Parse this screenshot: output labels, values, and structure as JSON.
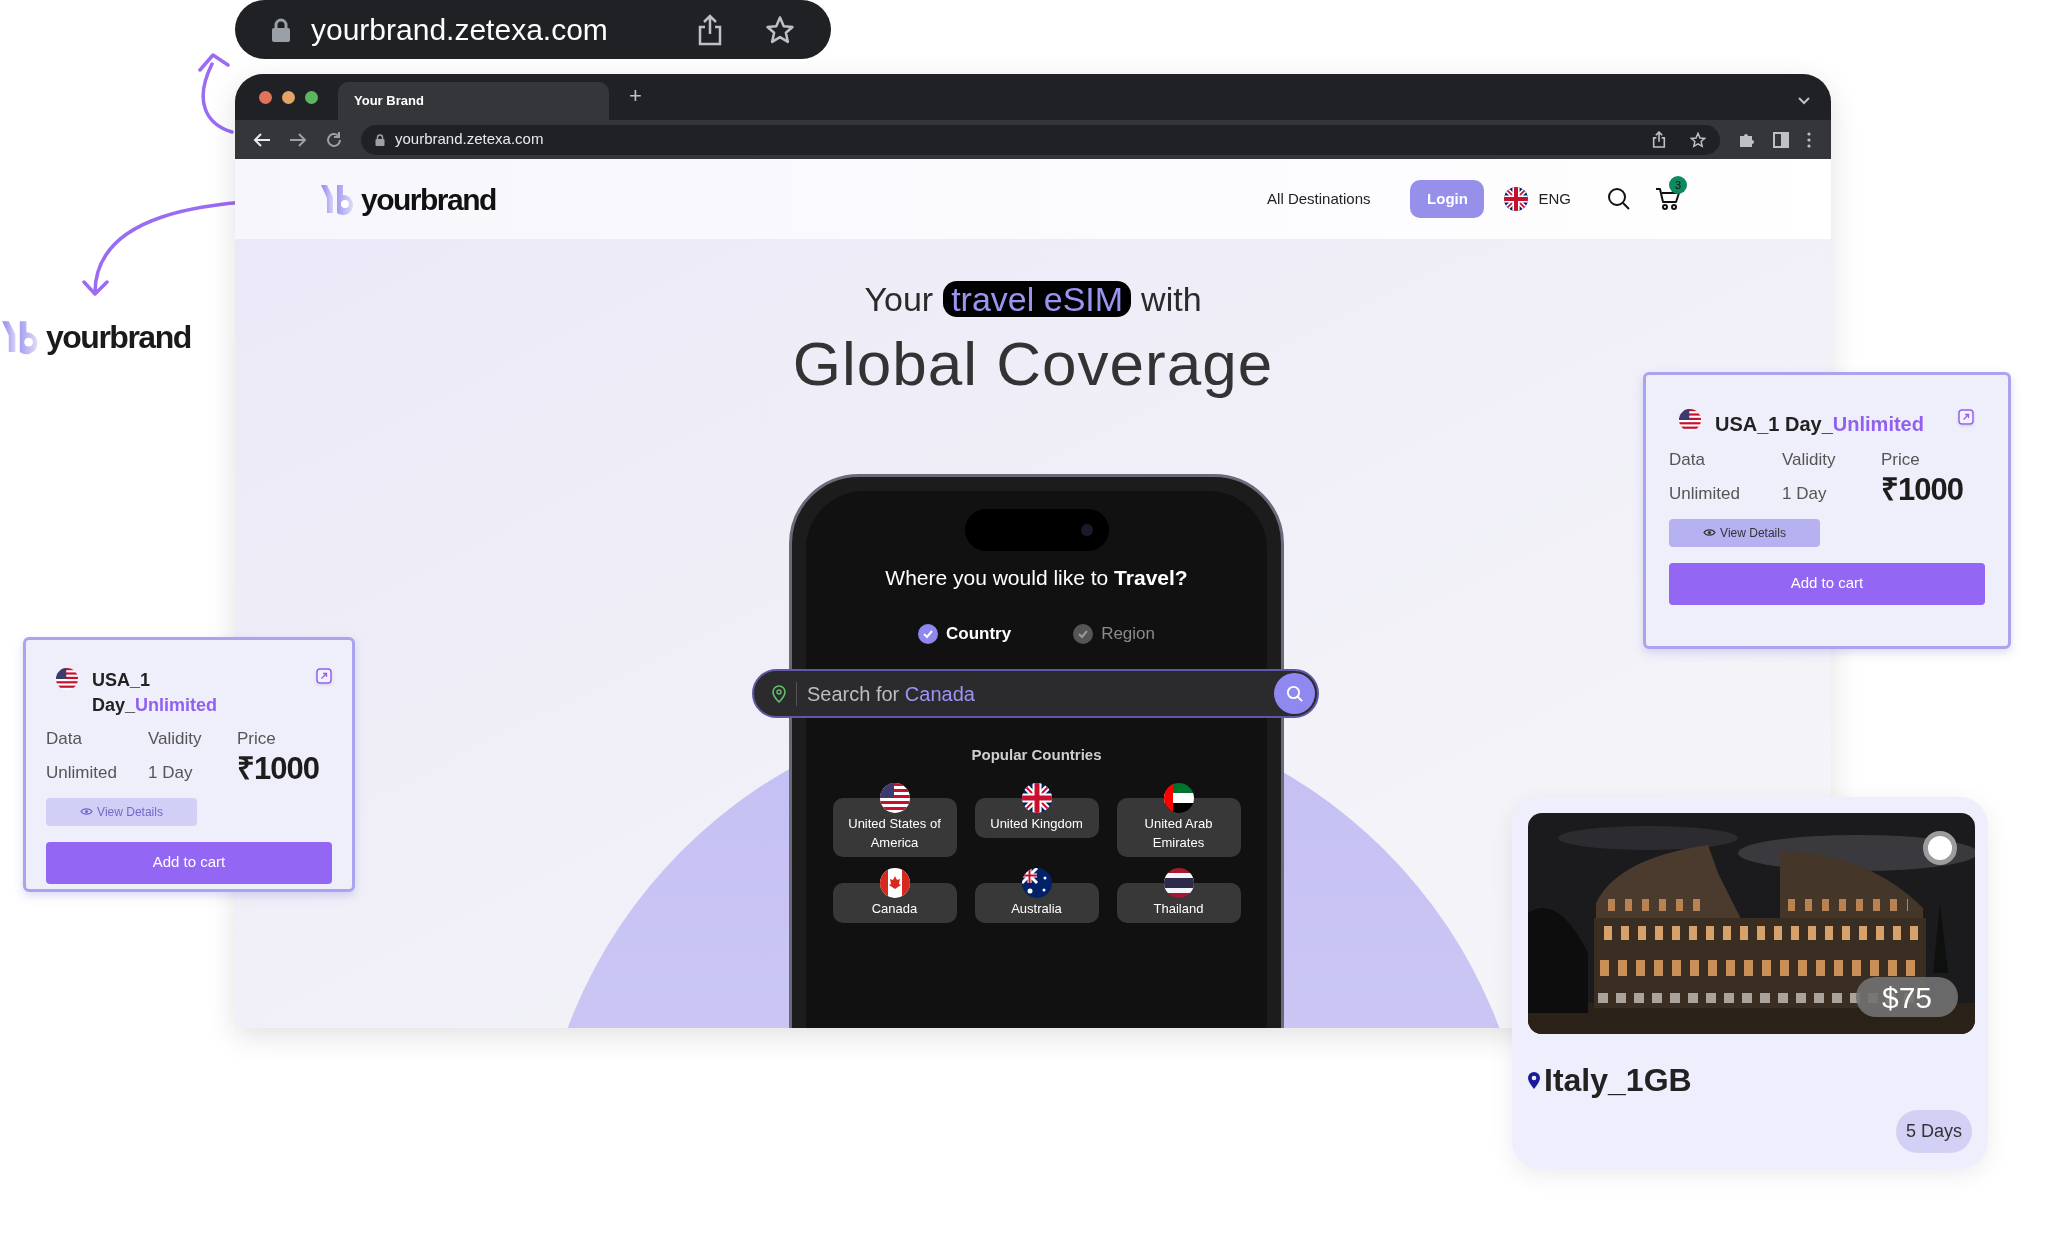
{
  "address_bar": {
    "url": "yourbrand.zetexa.com"
  },
  "browser": {
    "tabs": [
      {
        "title": "Your Brand",
        "selected": true
      }
    ],
    "new_tab": "+",
    "url": "yourbrand.zetexa.com"
  },
  "site": {
    "logo": "yourbrand",
    "nav": [
      "All Destinations"
    ],
    "login": "Login",
    "language": "ENG",
    "cart_count": "3"
  },
  "hero": {
    "before": "Your",
    "highlight": "travel eSIM",
    "after": "with",
    "title": "Global Coverage"
  },
  "phone": {
    "question": "Where you would like to **Travel?**",
    "options": [
      {
        "label": "Country",
        "selected": true
      },
      {
        "label": "Region",
        "selected": false
      }
    ],
    "search_prefix": "Search for",
    "search_term": "Canada",
    "popular_title": "Popular Countries",
    "countries": [
      {
        "name": "United States of America"
      },
      {
        "name": "United Kingdom"
      },
      {
        "name": "United Arab Emirates"
      },
      {
        "name": "Canada"
      },
      {
        "name": "Australia"
      },
      {
        "name": "Thailand"
      }
    ]
  },
  "side_logo": "yourbrand",
  "plan_cards": [
    {
      "name": "USA_1 Day_",
      "plan": "Unlimited",
      "data_label": "Data",
      "data": "Unlimited",
      "validity_label": "Validity",
      "validity": "1 Day",
      "price_label": "Price",
      "price": "₹1000",
      "details": "View Details",
      "details_disabled": true,
      "cart": "Add to cart"
    },
    {
      "name": "USA_1 Day_",
      "plan": "Unlimited",
      "data_label": "Data",
      "data": "Unlimited",
      "validity_label": "Validity",
      "validity": "1 Day",
      "price_label": "Price",
      "price": "₹1000",
      "details": "View Details",
      "details_disabled": false,
      "cart": "Add to cart"
    }
  ],
  "italy_card": {
    "kind": "picture",
    "price": "$75",
    "name": "Italy_1GB",
    "duration": "5 Days",
    "selected": false
  }
}
